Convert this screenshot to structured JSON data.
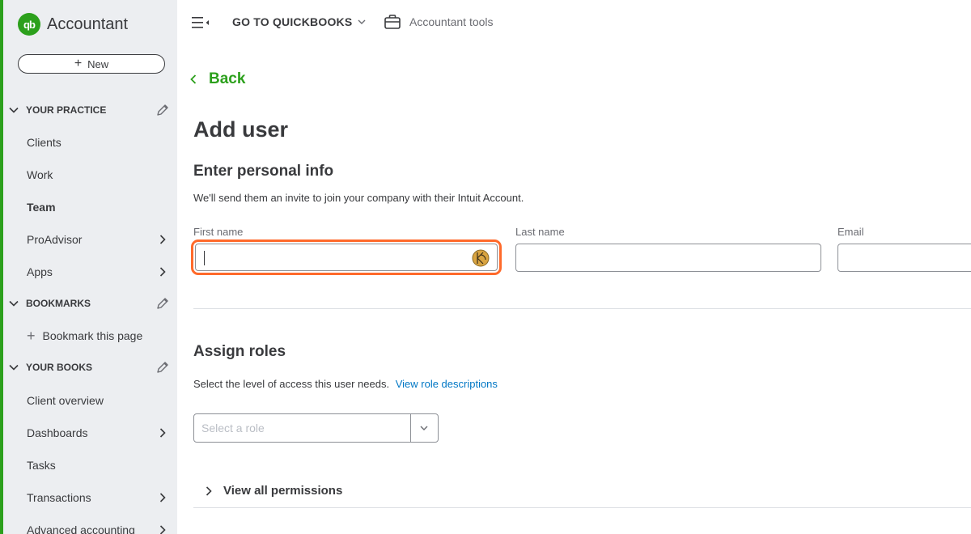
{
  "app": {
    "brand_logo": "qb",
    "brand_name": "Accountant"
  },
  "sidebar": {
    "new_label": "New",
    "sections": {
      "practice": "YOUR PRACTICE",
      "bookmarks": "BOOKMARKS",
      "books": "YOUR BOOKS"
    },
    "practice_items": [
      "Clients",
      "Work",
      "Team",
      "ProAdvisor",
      "Apps"
    ],
    "bookmark_item": "Bookmark this page",
    "books_items": [
      "Client overview",
      "Dashboards",
      "Tasks",
      "Transactions",
      "Advanced accounting"
    ],
    "active_item": "Team"
  },
  "topbar": {
    "goto_label": "GO TO QUICKBOOKS",
    "tools_label": "Accountant tools"
  },
  "main": {
    "back_label": "Back",
    "title": "Add user",
    "personal_heading": "Enter personal info",
    "personal_help": "We'll send them an invite to join your company with their Intuit Account.",
    "first_name_label": "First name",
    "first_name_value": "",
    "last_name_label": "Last name",
    "last_name_value": "",
    "email_label": "Email",
    "email_value": "",
    "roles_heading": "Assign roles",
    "roles_help": "Select the level of access this user needs.",
    "roles_link": "View role descriptions",
    "role_placeholder": "Select a role",
    "permissions_label": "View all permissions"
  },
  "colors": {
    "brand_green": "#2ca01c",
    "highlight_orange": "#ff6a2b",
    "link_blue": "#0077c5",
    "sidebar_bg": "#eceef1"
  }
}
